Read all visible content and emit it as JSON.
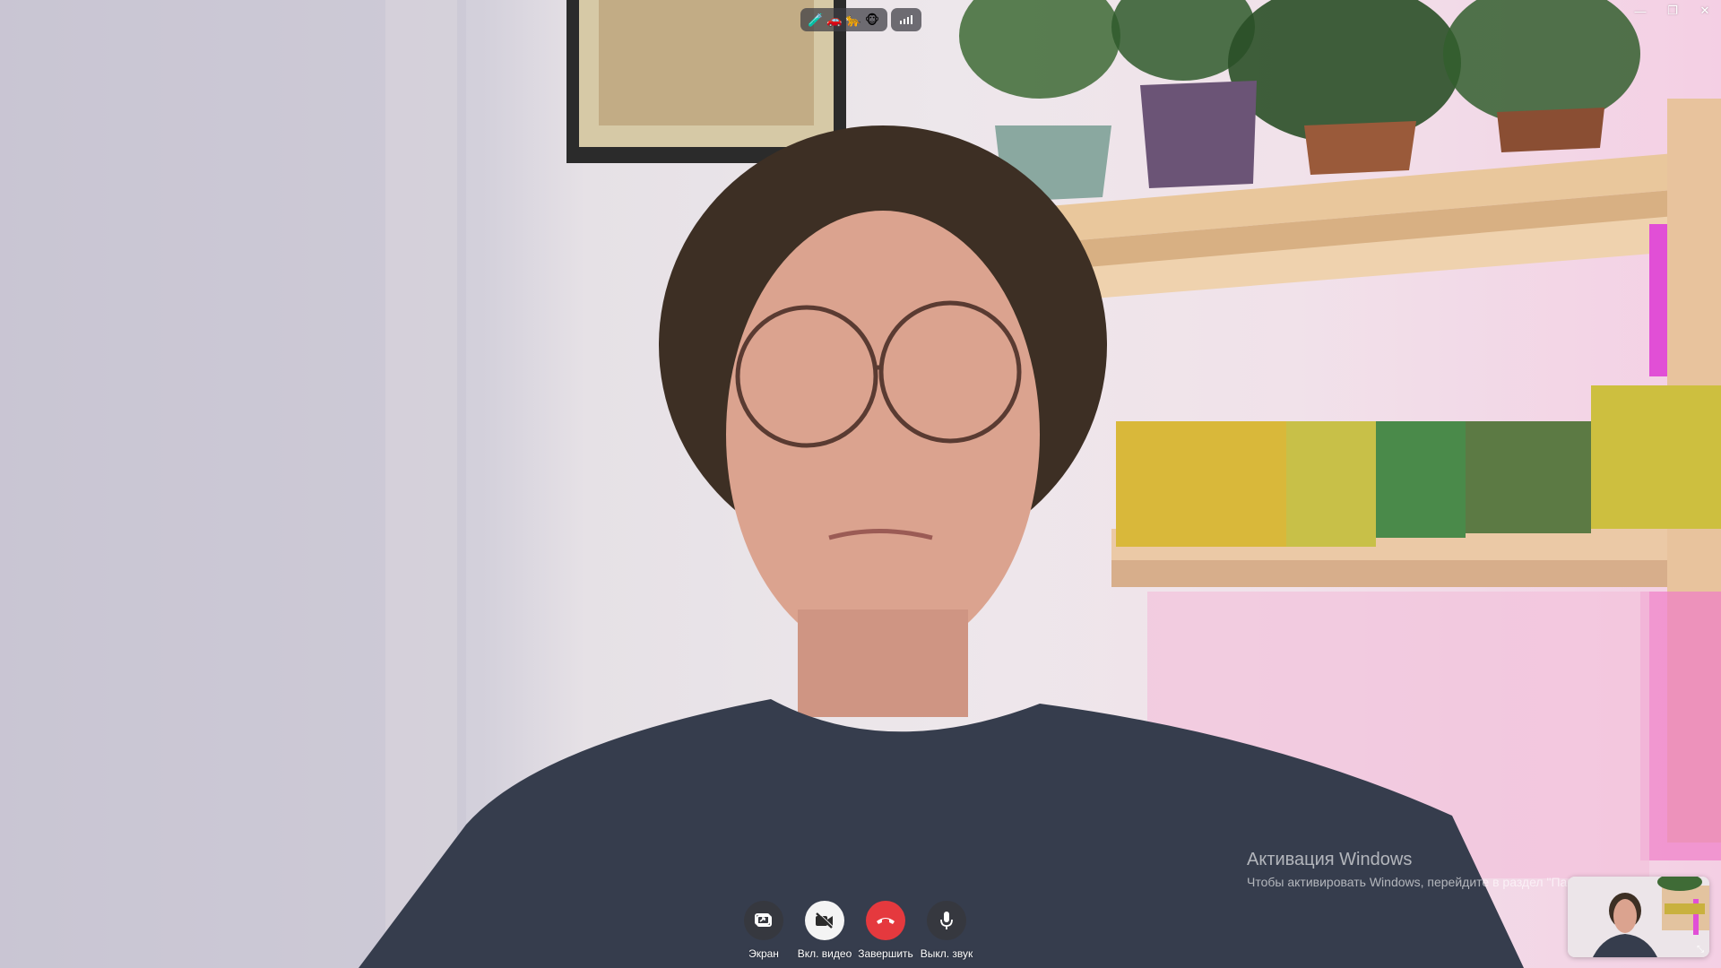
{
  "window_controls": {
    "minimize": "—",
    "restore": "❐",
    "close": "✕"
  },
  "status": {
    "emoji": [
      "🧪",
      "🚗",
      "🐆",
      "🐵"
    ],
    "signal_icon": "signal-bars-icon"
  },
  "watermark": {
    "title": "Активация Windows",
    "subtitle": "Чтобы активировать Windows, перейдите в раздел \"Пар"
  },
  "controls": {
    "screen_label": "Экран",
    "video_label": "Вкл. видео",
    "end_label": "Завершить",
    "mute_label": "Выкл. звук"
  },
  "colors": {
    "end_call": "#e5393e",
    "control_dark": "#37373c",
    "control_light": "#f4f4f4",
    "led_strip": "#e14fd6"
  }
}
